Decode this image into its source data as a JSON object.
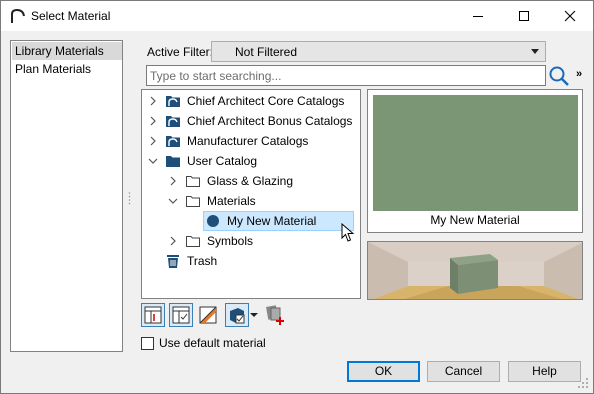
{
  "window": {
    "title": "Select Material"
  },
  "left_list": {
    "items": [
      {
        "label": "Library Materials",
        "selected": true
      },
      {
        "label": "Plan Materials",
        "selected": false
      }
    ]
  },
  "filter": {
    "label": "Active Filter:",
    "value": "Not Filtered"
  },
  "search": {
    "placeholder": "Type to start searching..."
  },
  "tree": {
    "nodes": [
      {
        "label": "Chief Architect Core Catalogs",
        "icon": "catalog-folder-icon",
        "expanded": false
      },
      {
        "label": "Chief Architect Bonus Catalogs",
        "icon": "catalog-folder-icon",
        "expanded": false
      },
      {
        "label": "Manufacturer Catalogs",
        "icon": "catalog-folder-icon",
        "expanded": false
      },
      {
        "label": "User Catalog",
        "icon": "folder-icon",
        "expanded": true
      },
      {
        "label": "Glass & Glazing",
        "icon": "folder-outline-icon",
        "expanded": false
      },
      {
        "label": "Materials",
        "icon": "folder-outline-icon",
        "expanded": true
      },
      {
        "label": "My New Material",
        "icon": "material-dot-icon",
        "selected": true
      },
      {
        "label": "Symbols",
        "icon": "folder-outline-icon",
        "expanded": false
      },
      {
        "label": "Trash",
        "icon": "trash-icon"
      }
    ]
  },
  "preview": {
    "material_name": "My New Material",
    "swatch_color": "#7a9674"
  },
  "options": {
    "use_default_label": "Use default material",
    "use_default_checked": false
  },
  "buttons": {
    "ok": "OK",
    "cancel": "Cancel",
    "help": "Help"
  }
}
